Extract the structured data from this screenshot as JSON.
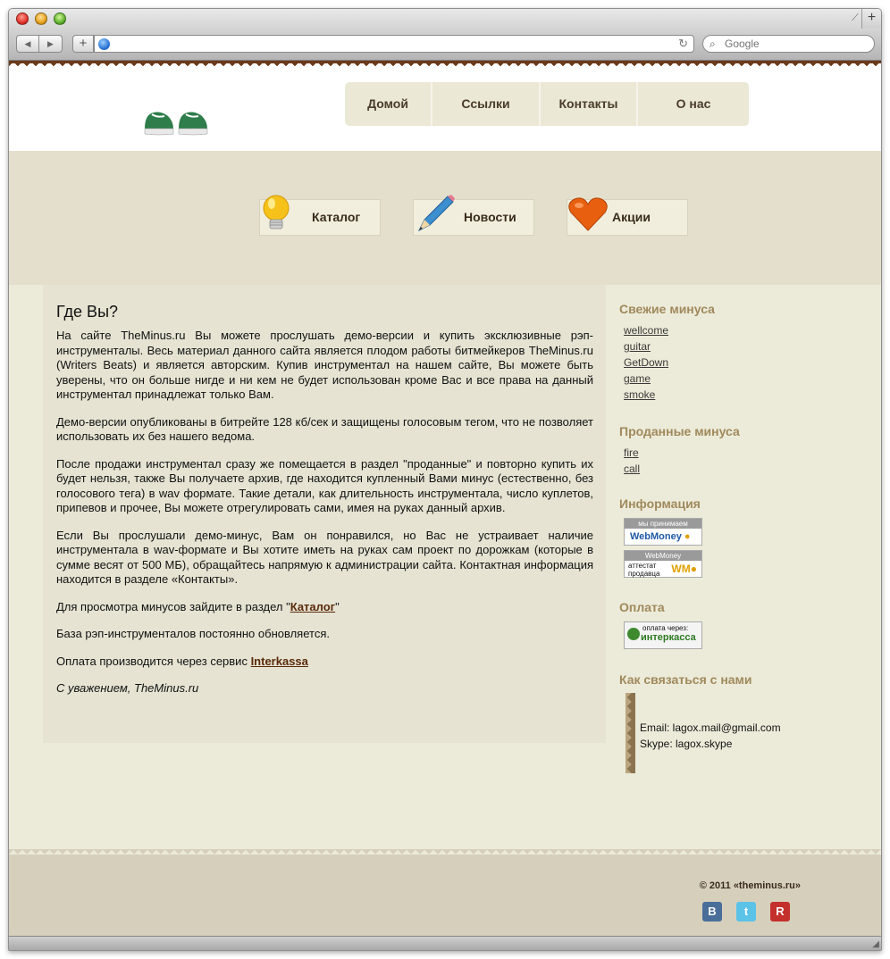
{
  "browser": {
    "search_placeholder": "Google",
    "url": ""
  },
  "nav": {
    "items": [
      "Домой",
      "Ссылки",
      "Контакты",
      "О нас"
    ]
  },
  "categories": [
    {
      "label": "Каталог",
      "icon": "lightbulb-icon"
    },
    {
      "label": "Новости",
      "icon": "pencil-icon"
    },
    {
      "label": "Акции",
      "icon": "heart-icon"
    }
  ],
  "content": {
    "title": "Где Вы?",
    "p1": "На сайте TheMinus.ru Вы можете прослушать демо-версии и купить эксклюзивные рэп-инструменталы. Весь материал данного сайта является плодом работы битмейкеров TheMinus.ru (Writers Beats) и является авторским. Купив инструментал на нашем сайте, Вы можете быть уверены, что он больше нигде и ни кем не будет использован кроме Вас и все права на данный инструментал принадлежат только Вам.",
    "p2": "Демо-версии опубликованы в битрейте 128 кб/сек и защищены голосовым тегом, что не позволяет использовать их без нашего ведома.",
    "p3": "После продажи инструментал сразу же помещается в раздел \"проданные\" и повторно купить их будет нельзя, также Вы получаете архив, где находится купленный Вами минус (естественно, без голосового тега) в wav формате. Такие детали, как длительность инструментала, число куплетов, припевов и прочее, Вы можете отрегулировать сами, имея на руках данный архив.",
    "p4": "Если Вы прослушали демо-минус, Вам он понравился, но Вас не устраивает наличие инструментала в wav-формате и Вы хотите иметь на руках сам проект по дорожкам (которые в сумме весят от 500 МБ), обращайтесь напрямую к администрации сайта. Контактная информация находится в разделе «Контакты».",
    "p5_prefix": "Для просмотра минусов зайдите в раздел \"",
    "p5_link": "Каталог",
    "p5_suffix": "\"",
    "p6": "База рэп-инструменталов постоянно обновляется.",
    "p7_prefix": "Оплата производится через сервис ",
    "p7_link": "Interkassa",
    "sign": "С уважением, TheMinus.ru"
  },
  "sidebar": {
    "fresh_title": "Свежие минуса",
    "fresh": [
      "wellcome",
      "guitar",
      "GetDown",
      "game",
      "smoke"
    ],
    "sold_title": "Проданные минуса",
    "sold": [
      "fire",
      "call"
    ],
    "info_title": "Информация",
    "badge1_top": "мы принимаем",
    "badge1_bottom": "WebMoney",
    "badge2_top": "WebMoney",
    "badge2_bottom": "аттестат продавца",
    "pay_title": "Оплата",
    "pay_badge_top": "оплата через:",
    "pay_badge_bottom": "интеркасса",
    "contact_title": "Как связаться с нами",
    "email": "Email: lagox.mail@gmail.com",
    "skype": "Skype: lagox.skype"
  },
  "footer": {
    "copyright": "© 2011 «theminus.ru»",
    "social": [
      {
        "icon": "vkontakte-icon",
        "glyph": "B",
        "color": "#4a6e9a"
      },
      {
        "icon": "twitter-icon",
        "glyph": "t",
        "color": "#5bc2e8"
      },
      {
        "icon": "rails-icon",
        "glyph": "R",
        "color": "#c4302b"
      }
    ]
  }
}
